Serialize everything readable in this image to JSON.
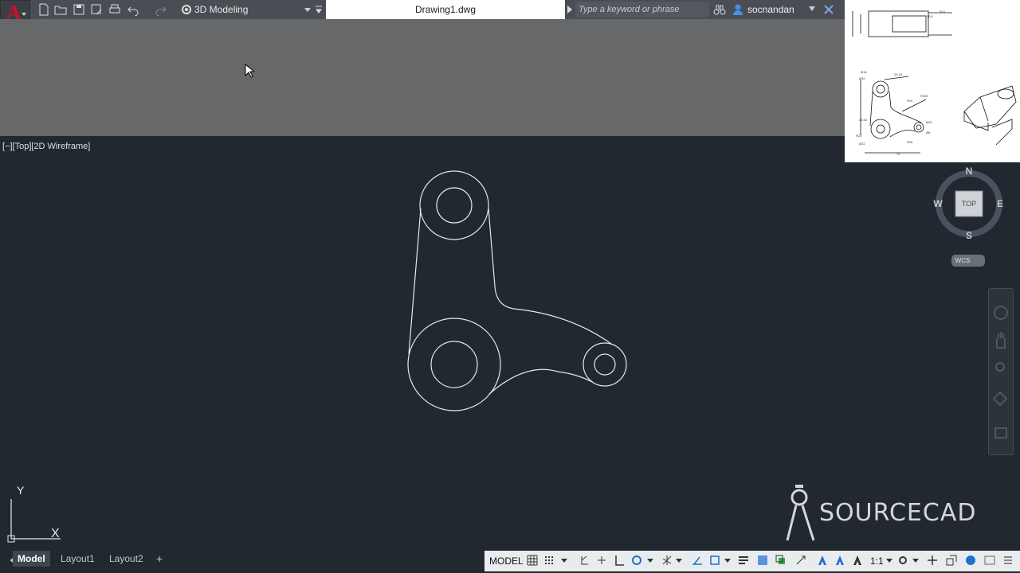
{
  "app": {
    "logo_letter": "A"
  },
  "quick_access": {
    "workspace": "3D Modeling",
    "icons": [
      "new-icon",
      "open-icon",
      "save-icon",
      "saveas-icon",
      "print-icon",
      "undo-icon",
      "redo-icon"
    ]
  },
  "document": {
    "title": "Drawing1.dwg"
  },
  "search": {
    "placeholder": "Type a keyword or phrase"
  },
  "user": {
    "name": "socnandan"
  },
  "viewport": {
    "label": "[−][Top][2D Wireframe]"
  },
  "viewcube": {
    "north": "N",
    "south": "S",
    "east": "E",
    "west": "W",
    "face": "TOP",
    "ucs_label": "WCS"
  },
  "ucs_icon": {
    "y": "Y",
    "x": "X"
  },
  "watermark": {
    "text": "SOURCECAD"
  },
  "layout_tabs": [
    {
      "label": "Model"
    },
    {
      "label": "Layout1"
    },
    {
      "label": "Layout2"
    },
    {
      "label": "+"
    }
  ],
  "status_bar": {
    "model": "MODEL",
    "scale": "1:1"
  },
  "colors": {
    "accent": "#c8102e",
    "canvas": "#212830",
    "ribbon": "#676869",
    "wireframe": "#e8e8e8"
  }
}
